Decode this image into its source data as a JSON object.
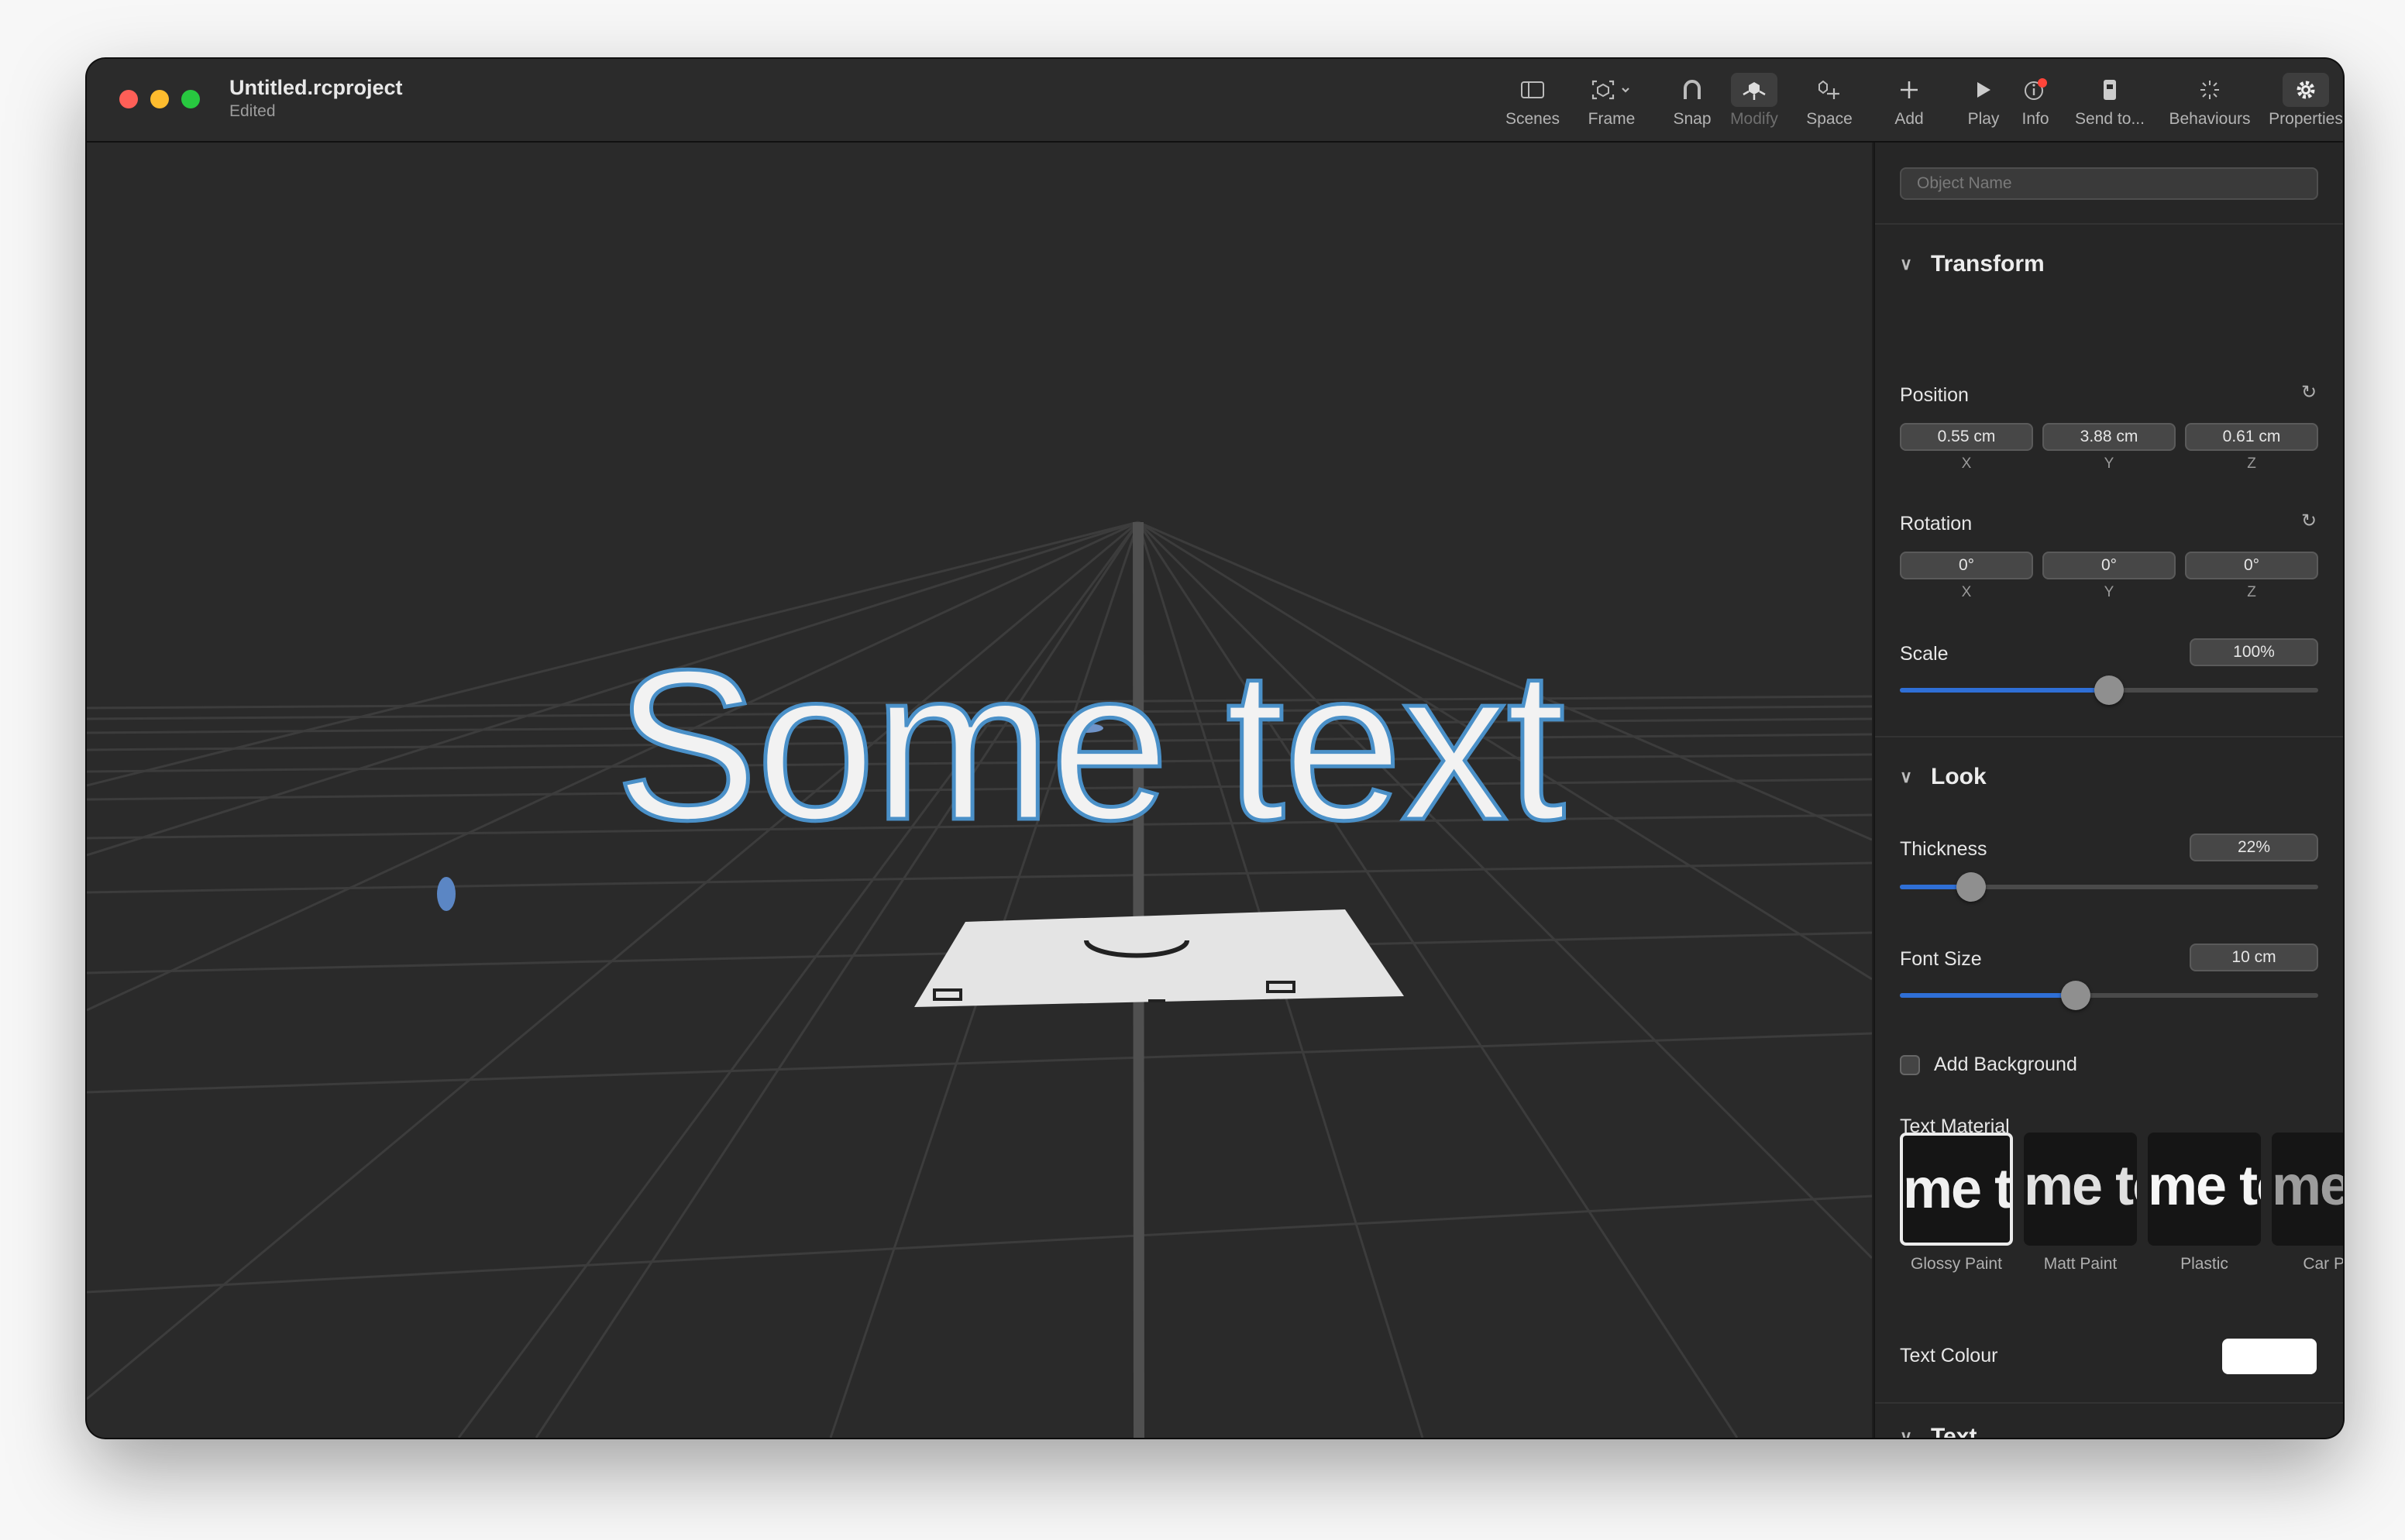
{
  "window": {
    "title": "Untitled.rcproject",
    "subtitle": "Edited"
  },
  "toolbar": [
    {
      "key": "scenes",
      "label": "Scenes",
      "icon": "sidebar-icon"
    },
    {
      "key": "frame",
      "label": "Frame",
      "icon": "frame-icon"
    },
    {
      "key": "snap",
      "label": "Snap",
      "icon": "magnet-icon"
    },
    {
      "key": "modify",
      "label": "Modify",
      "icon": "modify-icon"
    },
    {
      "key": "space",
      "label": "Space",
      "icon": "space-icon"
    },
    {
      "key": "add",
      "label": "Add",
      "icon": "plus-icon"
    },
    {
      "key": "play",
      "label": "Play",
      "icon": "play-icon"
    },
    {
      "key": "info",
      "label": "Info",
      "icon": "info-icon"
    },
    {
      "key": "send",
      "label": "Send to...",
      "icon": "phone-icon"
    },
    {
      "key": "behaviours",
      "label": "Behaviours",
      "icon": "sparkle-icon"
    },
    {
      "key": "properties",
      "label": "Properties",
      "icon": "gear-icon"
    }
  ],
  "viewport": {
    "text": "Some text"
  },
  "inspector": {
    "object_name_placeholder": "Object Name",
    "transform": {
      "title": "Transform",
      "position_label": "Position",
      "position": {
        "x": "0.55 cm",
        "y": "3.88 cm",
        "z": "0.61 cm"
      },
      "rotation_label": "Rotation",
      "rotation": {
        "x": "0°",
        "y": "0°",
        "z": "0°"
      },
      "axes": {
        "x": "X",
        "y": "Y",
        "z": "Z"
      },
      "scale_label": "Scale",
      "scale": "100%",
      "scale_fraction": 0.5
    },
    "look": {
      "title": "Look",
      "thickness_label": "Thickness",
      "thickness": "22%",
      "thickness_fraction": 0.17,
      "font_size_label": "Font Size",
      "font_size": "10 cm",
      "font_size_fraction": 0.42,
      "add_background_label": "Add Background",
      "text_material_label": "Text Material",
      "materials": [
        {
          "name": "Glossy Paint",
          "sample": "me te"
        },
        {
          "name": "Matt Paint",
          "sample": "me te"
        },
        {
          "name": "Plastic",
          "sample": "me te"
        },
        {
          "name": "Car Pa",
          "sample": "me"
        }
      ],
      "text_colour_label": "Text Colour",
      "text_colour": "#ffffff"
    },
    "text_section": {
      "title": "Text"
    }
  },
  "colors": {
    "accent": "#2f6fd6",
    "text_outline": "#4a90c8"
  }
}
